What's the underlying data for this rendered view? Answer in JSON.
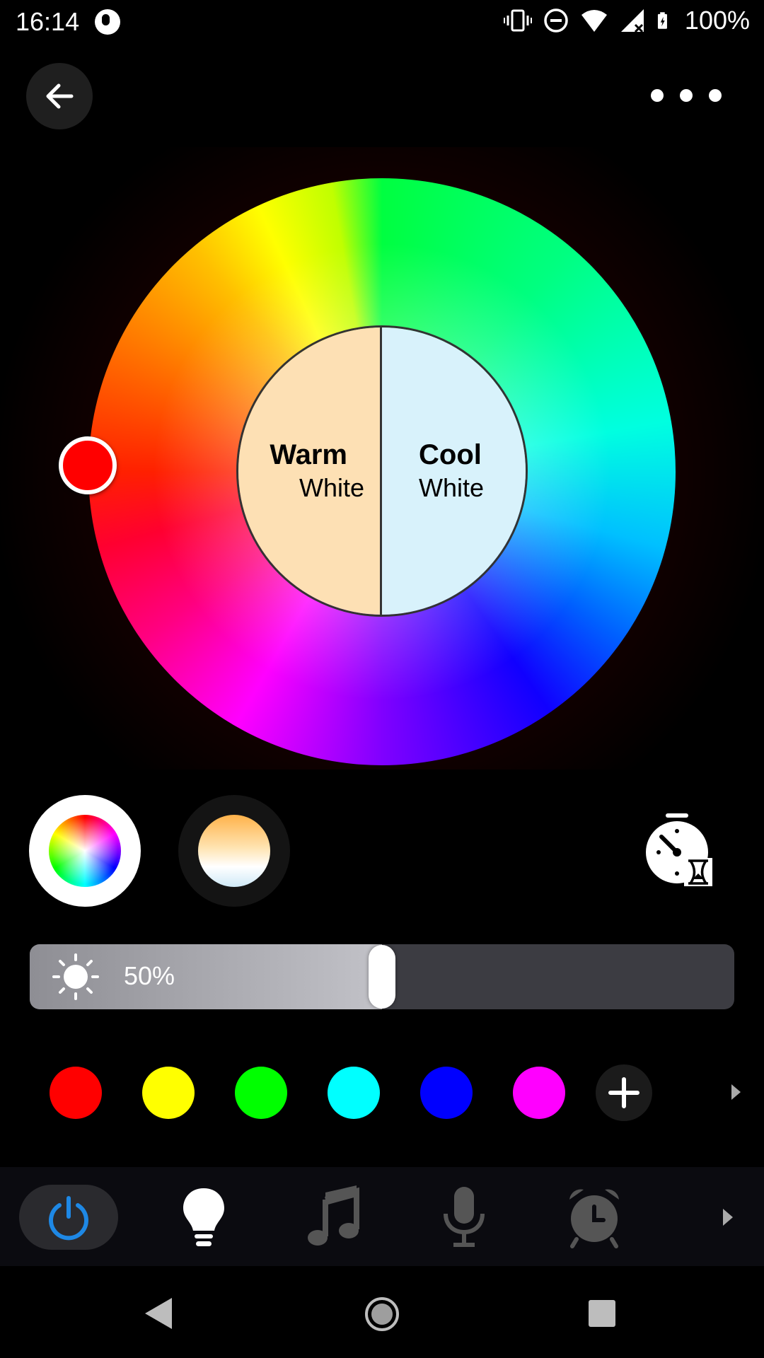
{
  "status_bar": {
    "time": "16:14",
    "battery": "100%",
    "icons": [
      "app-notification-icon",
      "vibrate-icon",
      "do-not-disturb-icon",
      "wifi-icon",
      "signal-icon",
      "battery-charging-icon"
    ]
  },
  "top_bar": {
    "back_icon": "arrow-left-icon",
    "more_icon": "more-horizontal-icon"
  },
  "color_wheel": {
    "selected_color": "#ff0000",
    "warm": {
      "title": "Warm",
      "subtitle": "White",
      "color": "#fde0b4"
    },
    "cool": {
      "title": "Cool",
      "subtitle": "White",
      "color": "#d8f2fb"
    }
  },
  "modes": {
    "active": "color",
    "items": [
      "color-mode",
      "white-mode"
    ],
    "timer_icon": "timer-icon"
  },
  "brightness": {
    "label": "50%",
    "value": 0.5,
    "icon": "sun-icon"
  },
  "presets": {
    "colors": [
      "#ff0000",
      "#ffff00",
      "#00ff00",
      "#00ffff",
      "#0000ff",
      "#ff00ff"
    ],
    "add_icon": "plus-icon"
  },
  "tabs": {
    "active": "light",
    "items": [
      "power-icon",
      "bulb-icon",
      "music-icon",
      "microphone-icon",
      "alarm-icon"
    ],
    "accent": "#1e88e5"
  },
  "nav_bar": {
    "items": [
      "nav-back-icon",
      "nav-home-icon",
      "nav-recents-icon"
    ]
  }
}
